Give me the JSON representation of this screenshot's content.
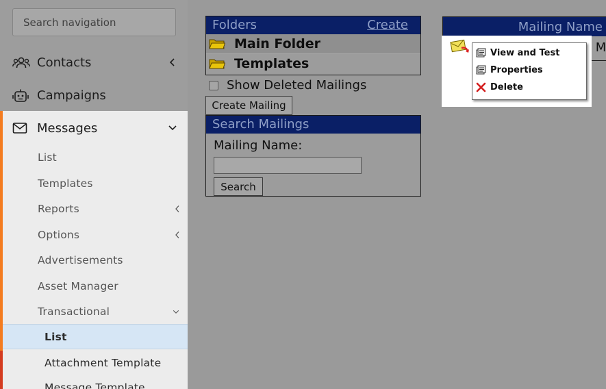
{
  "sidebar": {
    "search_placeholder": "Search navigation",
    "nav": [
      {
        "label": "Contacts",
        "icon": "users-icon",
        "chevron": "left"
      },
      {
        "label": "Campaigns",
        "icon": "robot-icon"
      },
      {
        "label": "Messages",
        "icon": "envelope-icon",
        "chevron": "down"
      }
    ],
    "messages_items": [
      {
        "label": "List"
      },
      {
        "label": "Templates"
      },
      {
        "label": "Reports",
        "chevron": "left"
      },
      {
        "label": "Options",
        "chevron": "left"
      },
      {
        "label": "Advertisements"
      },
      {
        "label": "Asset Manager"
      },
      {
        "label": "Transactional",
        "chevron": "down"
      }
    ],
    "transactional_items": [
      {
        "label": "List",
        "active": true
      },
      {
        "label": "Attachment Template"
      },
      {
        "label": "Message Template"
      }
    ]
  },
  "folders": {
    "title": "Folders",
    "create_link": "Create",
    "items": [
      {
        "label": "Main Folder",
        "icon": "folder-icon"
      },
      {
        "label": "Templates",
        "icon": "folder-icon"
      }
    ]
  },
  "show_deleted": {
    "label": "Show Deleted Mailings",
    "checked": false
  },
  "create_mailing_button": "Create Mailing",
  "search_mailings": {
    "title": "Search Mailings",
    "field_label": "Mailing Name:",
    "field_value": "",
    "search_button": "Search"
  },
  "mailing_table": {
    "column_header": "Mailing Name",
    "row_tail_text": "l M"
  },
  "context_menu": {
    "items": [
      {
        "label": "View and Test",
        "icon": "view-test-icon"
      },
      {
        "label": "Properties",
        "icon": "properties-icon"
      },
      {
        "label": "Delete",
        "icon": "delete-x-icon"
      }
    ]
  },
  "colors": {
    "accent_orange": "#f47c20",
    "accent_red": "#d43c20",
    "panel_header_bg": "#0a1f66",
    "active_item_bg": "#d6e6f5"
  }
}
